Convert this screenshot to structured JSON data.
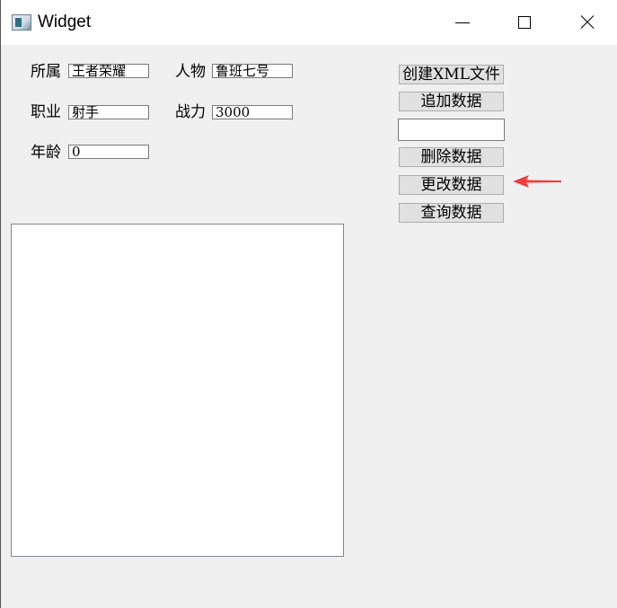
{
  "window": {
    "title": "Widget"
  },
  "form": {
    "affiliation_label": "所属",
    "affiliation_value": "王者荣耀",
    "character_label": "人物",
    "character_value": "鲁班七号",
    "role_label": "职业",
    "role_value": "射手",
    "power_label": "战力",
    "power_value": "3000",
    "age_label": "年龄",
    "age_value": "0"
  },
  "buttons": {
    "create_xml": "创建XML文件",
    "append": "追加数据",
    "delete": "删除数据",
    "modify": "更改数据",
    "query": "查询数据"
  },
  "query_input": {
    "value": ""
  },
  "annotation": {
    "arrow_color": "#f23c3c",
    "target": "更改数据"
  }
}
